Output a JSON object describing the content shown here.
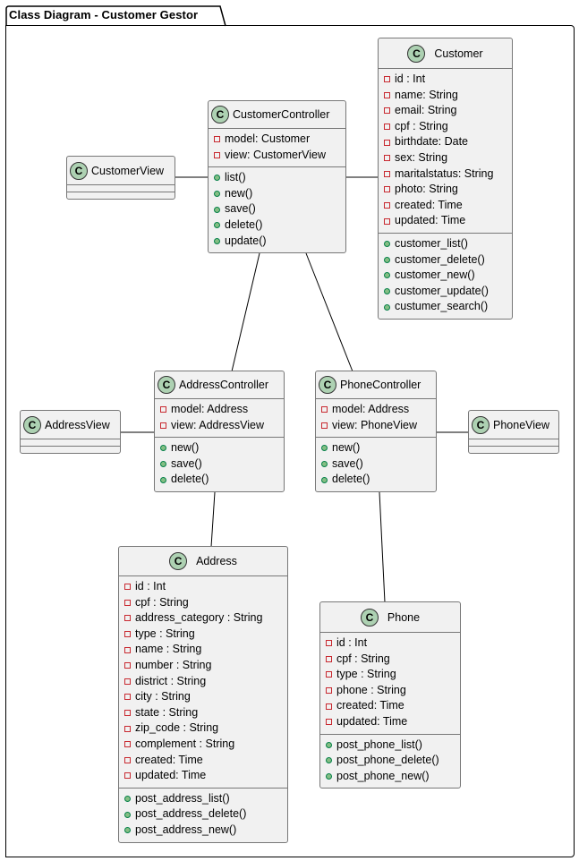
{
  "package": {
    "title": "Class Diagram - Customer Gestor"
  },
  "classes": {
    "customer": {
      "name": "Customer",
      "stereotype_letter": "C",
      "attributes": [
        "id : Int",
        "name: String",
        "email: String",
        "cpf : String",
        "birthdate: Date",
        "sex: String",
        "maritalstatus: String",
        "photo: String",
        "created: Time",
        "updated: Time"
      ],
      "methods": [
        "customer_list()",
        "customer_delete()",
        "customer_new()",
        "customer_update()",
        "custumer_search()"
      ]
    },
    "customer_controller": {
      "name": "CustomerController",
      "stereotype_letter": "C",
      "attributes": [
        "model: Customer",
        "view: CustomerView"
      ],
      "methods": [
        "list()",
        "new()",
        "save()",
        "delete()",
        "update()"
      ]
    },
    "customer_view": {
      "name": "CustomerView",
      "stereotype_letter": "C"
    },
    "address_controller": {
      "name": "AddressController",
      "stereotype_letter": "C",
      "attributes": [
        "model: Address",
        "view: AddressView"
      ],
      "methods": [
        "new()",
        "save()",
        "delete()"
      ]
    },
    "address_view": {
      "name": "AddressView",
      "stereotype_letter": "C"
    },
    "phone_controller": {
      "name": "PhoneController",
      "stereotype_letter": "C",
      "attributes": [
        "model: Address",
        "view: PhoneView"
      ],
      "methods": [
        "new()",
        "save()",
        "delete()"
      ]
    },
    "phone_view": {
      "name": "PhoneView",
      "stereotype_letter": "C"
    },
    "address": {
      "name": "Address",
      "stereotype_letter": "C",
      "attributes": [
        "id : Int",
        "cpf : String",
        "address_category : String",
        "type : String",
        "name : String",
        "number : String",
        "district : String",
        "city : String",
        "state : String",
        "zip_code : String",
        "complement : String",
        "created: Time",
        "updated: Time"
      ],
      "methods": [
        "post_address_list()",
        "post_address_delete()",
        "post_address_new()"
      ]
    },
    "phone": {
      "name": "Phone",
      "stereotype_letter": "C",
      "attributes": [
        "id : Int",
        "cpf : String",
        "type : String",
        "phone : String",
        "created: Time",
        "updated: Time"
      ],
      "methods": [
        "post_phone_list()",
        "post_phone_delete()",
        "post_phone_new()"
      ]
    }
  },
  "associations": [
    [
      "CustomerView",
      "CustomerController"
    ],
    [
      "CustomerController",
      "Customer"
    ],
    [
      "CustomerController",
      "AddressController"
    ],
    [
      "CustomerController",
      "PhoneController"
    ],
    [
      "AddressView",
      "AddressController"
    ],
    [
      "PhoneController",
      "PhoneView"
    ],
    [
      "AddressController",
      "Address"
    ],
    [
      "PhoneController",
      "Phone"
    ]
  ],
  "colors": {
    "class_fill": "#f1f1f1",
    "class_border": "#777777",
    "stereotype_circle": "#add1b2",
    "private_marker": "#c82930",
    "public_marker": "#84be84"
  }
}
